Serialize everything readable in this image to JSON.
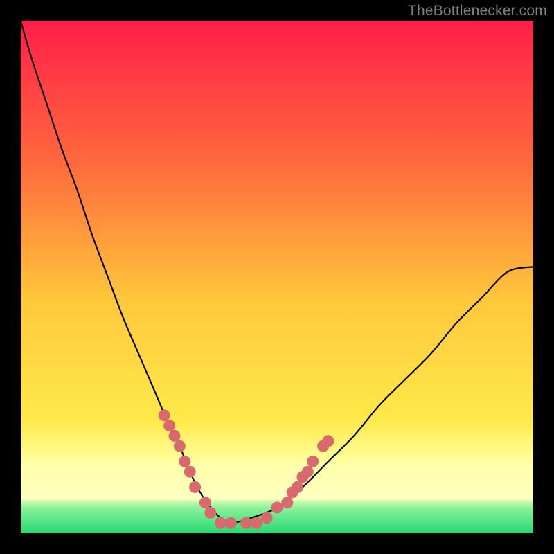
{
  "watermark": "TheBottlenecker.com",
  "colors": {
    "bg": "#000000",
    "top": "#ff1f4a",
    "mid1": "#ff7a3c",
    "mid2": "#ffd23c",
    "band": "#ffff99",
    "bottom": "#33e07a",
    "curve": "#000000",
    "dot": "#d86a6e",
    "watermark": "#808080"
  },
  "chart_data": {
    "type": "line",
    "title": "",
    "xlabel": "",
    "ylabel": "",
    "x": [
      0.0,
      0.02,
      0.05,
      0.08,
      0.11,
      0.14,
      0.17,
      0.2,
      0.23,
      0.26,
      0.29,
      0.31,
      0.33,
      0.35,
      0.37,
      0.39,
      0.41,
      0.45,
      0.5,
      0.55,
      0.6,
      0.65,
      0.7,
      0.75,
      0.8,
      0.85,
      0.9,
      0.95,
      1.0
    ],
    "y": [
      1.0,
      0.93,
      0.84,
      0.75,
      0.67,
      0.58,
      0.5,
      0.42,
      0.35,
      0.28,
      0.21,
      0.17,
      0.12,
      0.08,
      0.05,
      0.03,
      0.02,
      0.03,
      0.05,
      0.09,
      0.14,
      0.19,
      0.25,
      0.3,
      0.35,
      0.41,
      0.46,
      0.51,
      0.52
    ],
    "xlim": [
      0,
      1
    ],
    "ylim": [
      0,
      1
    ],
    "dots_x": [
      0.28,
      0.29,
      0.3,
      0.31,
      0.32,
      0.33,
      0.34,
      0.36,
      0.37,
      0.39,
      0.41,
      0.44,
      0.46,
      0.48,
      0.5,
      0.52,
      0.53,
      0.54,
      0.55,
      0.56,
      0.57,
      0.59,
      0.6
    ],
    "dots_y": [
      0.23,
      0.21,
      0.19,
      0.17,
      0.14,
      0.12,
      0.09,
      0.06,
      0.04,
      0.02,
      0.02,
      0.02,
      0.02,
      0.03,
      0.05,
      0.06,
      0.08,
      0.09,
      0.11,
      0.12,
      0.14,
      0.17,
      0.18
    ],
    "green_band_y": 0.06,
    "pale_band_y": 0.14
  }
}
